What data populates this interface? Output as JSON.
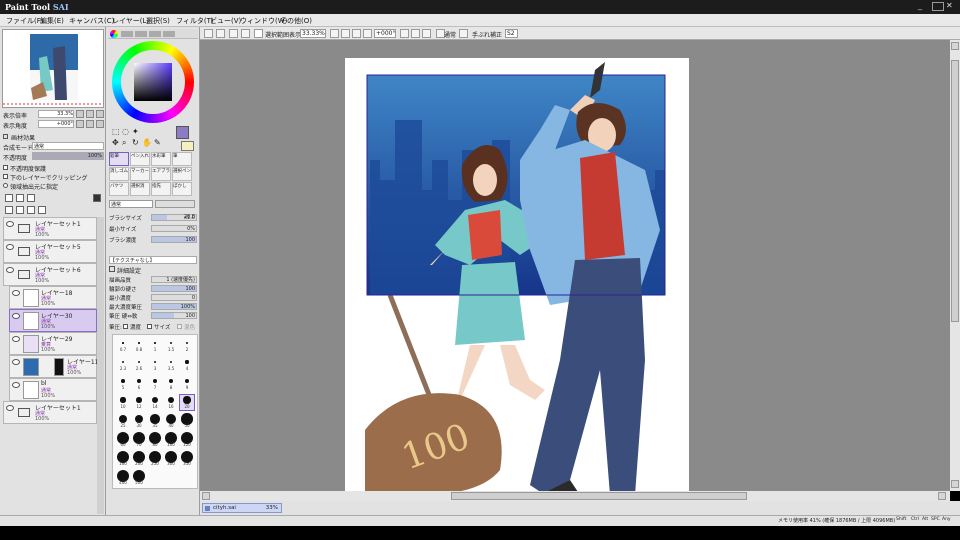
{
  "app": {
    "title": "SAI"
  },
  "menu": [
    "ファイル(F)",
    "編集(E)",
    "キャンバス(C)",
    "レイヤー(L)",
    "選択(S)",
    "フィルタ(T)",
    "ビュー(V)",
    "ウィンドウ(W)",
    "その他(O)"
  ],
  "toolbar": {
    "selection_label": "選択範囲表示",
    "zoom": "33.33%",
    "angle": "+000°",
    "stabilizer_label": "通常",
    "stabilizer_value": "手ぶれ補正",
    "stabilizer_num": "S2"
  },
  "navigator": {
    "zoom_label": "表示倍率",
    "zoom_value": "33.3%",
    "angle_label": "表示角度",
    "angle_value": "+000°"
  },
  "layer_panel": {
    "effect_label": "画材効果",
    "blend_label": "合成モード",
    "blend_value": "通常",
    "opacity_label": "不透明度",
    "opacity_value": "100%",
    "opacity_fraction": 1.0,
    "checks": [
      "不透明度保護",
      "下のレイヤーでクリッピング",
      "領域抽出元に指定"
    ]
  },
  "layers": [
    {
      "name": "レイヤーセット1",
      "mode": "通常",
      "opacity": "100%",
      "type": "folder",
      "selected": false
    },
    {
      "name": "レイヤーセット5",
      "mode": "通常",
      "opacity": "100%",
      "type": "folder",
      "selected": false
    },
    {
      "name": "レイヤーセット6",
      "mode": "通常",
      "opacity": "100%",
      "type": "folder",
      "selected": false
    },
    {
      "name": "レイヤー18",
      "mode": "通常",
      "opacity": "100%",
      "type": "layer",
      "selected": false
    },
    {
      "name": "レイヤー30",
      "mode": "通常",
      "opacity": "100%",
      "type": "layer",
      "selected": true
    },
    {
      "name": "レイヤー29",
      "mode": "乗算",
      "opacity": "100%",
      "type": "layer",
      "selected": false
    },
    {
      "name": "レイヤー11",
      "mode": "通常",
      "opacity": "100%",
      "type": "layer",
      "selected": false
    },
    {
      "name": "bl",
      "mode": "通常",
      "opacity": "100%",
      "type": "layer",
      "selected": false
    },
    {
      "name": "レイヤーセット1",
      "mode": "通常",
      "opacity": "100%",
      "type": "folder",
      "selected": false
    }
  ],
  "tools": {
    "presets": [
      "鉛筆",
      "ペン入れ",
      "水彩筆",
      "筆",
      "消しゴム",
      "マーカー",
      "エアブラシ",
      "選択ペン",
      "バケツ",
      "選択消",
      "指先",
      "ぼかし"
    ],
    "mode_value": "通常",
    "params": [
      {
        "label": "ブラシサイズ",
        "value": "x1.0",
        "num": "20.0",
        "fraction": 0.35
      },
      {
        "label": "最小サイズ",
        "value": "0%",
        "num": "",
        "fraction": 0.0
      },
      {
        "label": "ブラシ濃度",
        "value": "100",
        "num": "",
        "fraction": 1.0
      }
    ],
    "texture_label": "【テクスチャなし】",
    "detail_label": "詳細設定",
    "detail_rows": [
      {
        "label": "描画品質",
        "value": "1 (速度優先)",
        "fraction": 0
      },
      {
        "label": "輪郭の硬さ",
        "value": "100",
        "fraction": 1.0
      },
      {
        "label": "最小濃度",
        "value": "0",
        "fraction": 0.0
      },
      {
        "label": "最大濃度筆圧",
        "value": "100%",
        "fraction": 1.0
      },
      {
        "label": "筆圧 硬⇔軟",
        "value": "100",
        "fraction": 0.5
      }
    ],
    "pressure_label": "筆圧:",
    "pressure_density": "濃度",
    "pressure_size": "サイズ",
    "pressure_blend": "混色"
  },
  "brush_sizes": [
    "0.7",
    "0.8",
    "1",
    "1.5",
    "2",
    "2.3",
    "2.6",
    "3",
    "3.5",
    "4",
    "5",
    "6",
    "7",
    "8",
    "9",
    "10",
    "12",
    "14",
    "16",
    "20",
    "25",
    "30",
    "35",
    "40",
    "50",
    "60",
    "70",
    "80",
    "100",
    "120",
    "160",
    "200",
    "250",
    "300",
    "350",
    "400",
    "500"
  ],
  "tab": {
    "name": "cityh.sai",
    "zoom": "33%"
  },
  "status": {
    "memory": "メモリ使用率 41% (確保 1876MB / 上限 4096MB)",
    "keys": [
      "Shift",
      "Ctrl",
      "Alt",
      "SPC",
      "Any"
    ]
  },
  "colors": {
    "accent": "#7a5cc7",
    "wheel_square": "#322a6e",
    "current_color": "#8b7cc4",
    "canvas_bg": "#8a8a8a"
  }
}
